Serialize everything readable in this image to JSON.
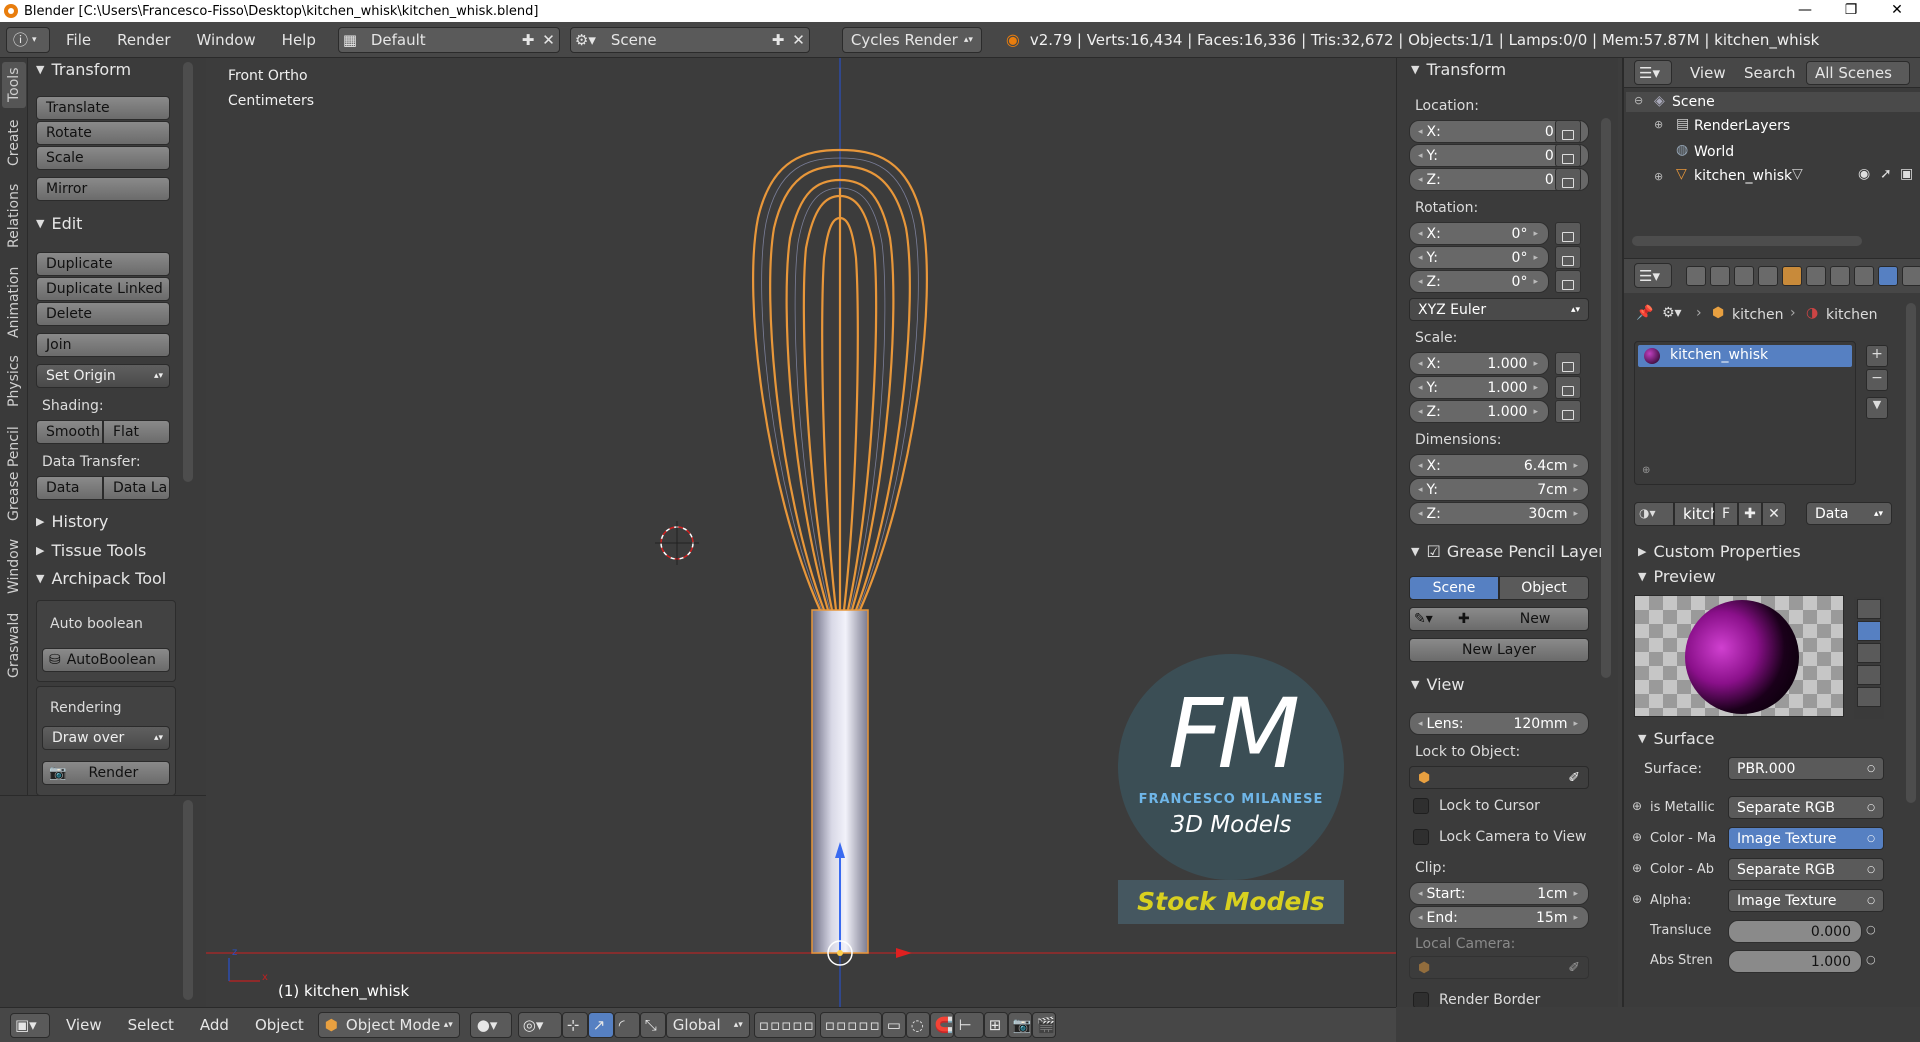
{
  "window": {
    "title": "Blender [C:\\Users\\Francesco-Fisso\\Desktop\\kitchen_whisk\\kitchen_whisk.blend]"
  },
  "info_header": {
    "menus": [
      "File",
      "Render",
      "Window",
      "Help"
    ],
    "screen_layout": "Default",
    "scene": "Scene",
    "render_engine": "Cycles Render",
    "stats": "v2.79 | Verts:16,434 | Faces:16,336 | Tris:32,672 | Objects:1/1 | Lamps:0/0 | Mem:57.87M | kitchen_whisk"
  },
  "tool_tabs": [
    "Tools",
    "Create",
    "Relations",
    "Animation",
    "Physics",
    "Grease Pencil",
    "Window",
    "Graswald"
  ],
  "tool_shelf": {
    "transform": {
      "header": "Transform",
      "translate": "Translate",
      "rotate": "Rotate",
      "scale": "Scale",
      "mirror": "Mirror"
    },
    "edit": {
      "header": "Edit",
      "duplicate": "Duplicate",
      "duplicate_linked": "Duplicate Linked",
      "delete": "Delete",
      "join": "Join",
      "set_origin": "Set Origin",
      "shading_label": "Shading:",
      "smooth": "Smooth",
      "flat": "Flat",
      "data_transfer_label": "Data Transfer:",
      "data": "Data",
      "data_la": "Data La"
    },
    "history": "History",
    "tissue_tools": "Tissue Tools",
    "archipack": {
      "header": "Archipack Tools",
      "auto_boolean_label": "Auto boolean",
      "auto_boolean_btn": "AutoBoolean",
      "rendering_label": "Rendering",
      "draw_over": "Draw over",
      "render": "Render"
    }
  },
  "viewport": {
    "view_name": "Front Ortho",
    "units": "Centimeters",
    "object_label": "(1) kitchen_whisk",
    "logo": {
      "letters": "FM",
      "name": "FRANCESCO MILANESE",
      "subtitle": "3D Models",
      "banner": "Stock Models"
    },
    "colors": {
      "bg": "#3c3c3c",
      "selection": "#e8973a",
      "axis_x": "#c02020",
      "axis_z": "#2050d0",
      "banner_text": "#d8d020"
    }
  },
  "properties_panel": {
    "transform": {
      "header": "Transform",
      "location_label": "Location:",
      "location": [
        {
          "axis": "X:",
          "value": "0m"
        },
        {
          "axis": "Y:",
          "value": "0m"
        },
        {
          "axis": "Z:",
          "value": "0m"
        }
      ],
      "rotation_label": "Rotation:",
      "rotation": [
        {
          "axis": "X:",
          "value": "0°"
        },
        {
          "axis": "Y:",
          "value": "0°"
        },
        {
          "axis": "Z:",
          "value": "0°"
        }
      ],
      "rotation_mode": "XYZ Euler",
      "scale_label": "Scale:",
      "scale": [
        {
          "axis": "X:",
          "value": "1.000"
        },
        {
          "axis": "Y:",
          "value": "1.000"
        },
        {
          "axis": "Z:",
          "value": "1.000"
        }
      ],
      "dimensions_label": "Dimensions:",
      "dimensions": [
        {
          "axis": "X:",
          "value": "6.4cm"
        },
        {
          "axis": "Y:",
          "value": "7cm"
        },
        {
          "axis": "Z:",
          "value": "30cm"
        }
      ]
    },
    "grease_pencil": {
      "header": "Grease Pencil Layer",
      "scene": "Scene",
      "object": "Object",
      "new": "New",
      "new_layer": "New Layer"
    },
    "view": {
      "header": "View",
      "lens_label": "Lens:",
      "lens": "120mm",
      "lock_object_label": "Lock to Object:",
      "lock_cursor": "Lock to Cursor",
      "lock_camera": "Lock Camera to View",
      "clip_label": "Clip:",
      "clip_start_label": "Start:",
      "clip_start": "1cm",
      "clip_end_label": "End:",
      "clip_end": "15m",
      "local_camera_label": "Local Camera:",
      "render_border": "Render Border"
    }
  },
  "outliner": {
    "view": "View",
    "search": "Search",
    "filter": "All Scenes",
    "items": [
      "Scene",
      "RenderLayers",
      "World",
      "kitchen_whisk"
    ]
  },
  "material_panel": {
    "breadcrumb": [
      "kitchen",
      "kitchen"
    ],
    "material_slot": "kitchen_whisk",
    "datablock_name": "kitch",
    "datablock_flag": "F",
    "link": "Data",
    "custom_properties": "Custom Properties",
    "preview": "Preview",
    "surface_header": "Surface",
    "surface_label": "Surface:",
    "surface_value": "PBR.000",
    "inputs": [
      {
        "label": "is Metallic",
        "value": "Separate RGB"
      },
      {
        "label": "Color - Ma",
        "value": "Image Texture"
      },
      {
        "label": "Color - Ab",
        "value": "Separate RGB"
      },
      {
        "label": "Alpha:",
        "value": "Image Texture"
      }
    ],
    "translucency_label": "Transluce",
    "translucency": "0.000",
    "abs_strength_label": "Abs Stren",
    "abs_strength": "1.000"
  },
  "footer": {
    "view": "View",
    "select": "Select",
    "add": "Add",
    "object": "Object",
    "mode": "Object Mode",
    "orientation": "Global"
  }
}
